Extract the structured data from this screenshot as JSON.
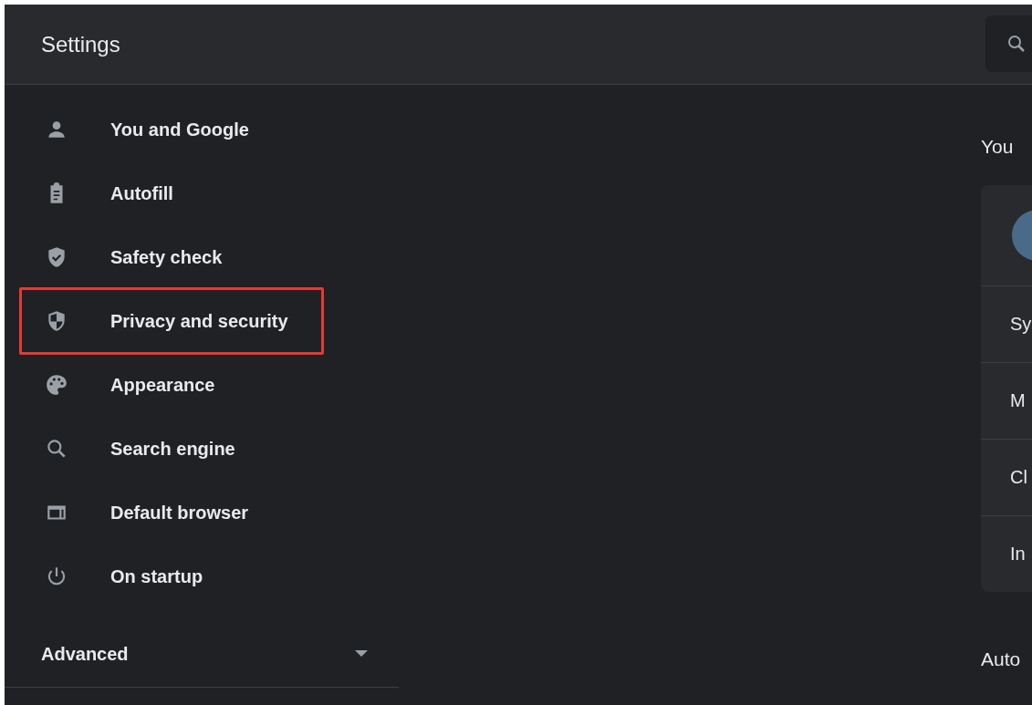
{
  "header": {
    "title": "Settings"
  },
  "sidebar": {
    "items": [
      {
        "label": "You and Google",
        "highlighted": false
      },
      {
        "label": "Autofill",
        "highlighted": false
      },
      {
        "label": "Safety check",
        "highlighted": false
      },
      {
        "label": "Privacy and security",
        "highlighted": true
      },
      {
        "label": "Appearance",
        "highlighted": false
      },
      {
        "label": "Search engine",
        "highlighted": false
      },
      {
        "label": "Default browser",
        "highlighted": false
      },
      {
        "label": "On startup",
        "highlighted": false
      }
    ],
    "advanced": {
      "label": "Advanced",
      "expanded": false
    }
  },
  "main": {
    "section_title": "You",
    "card_rows": [
      {
        "kind": "avatar"
      },
      {
        "kind": "text",
        "label": "Sy"
      },
      {
        "kind": "text",
        "label": "M"
      },
      {
        "kind": "text",
        "label": "Cl"
      },
      {
        "kind": "text",
        "label": "In"
      }
    ],
    "next_section_title": "Auto"
  }
}
